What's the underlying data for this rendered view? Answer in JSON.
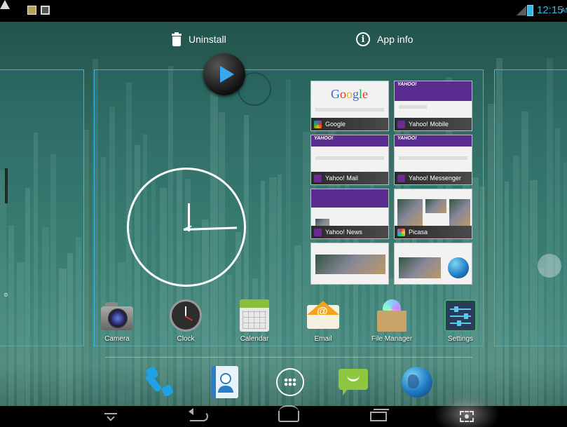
{
  "status_bar": {
    "left_icons": [
      "warning-icon",
      "sd-card-icon",
      "image-icon"
    ],
    "time": "12:15",
    "ampm": "AM",
    "accent_color": "#33b5e5"
  },
  "drop_targets": {
    "uninstall": "Uninstall",
    "app_info": "App info"
  },
  "recent_apps": [
    {
      "label": "Google",
      "icon": "google-icon"
    },
    {
      "label": "Yahoo! Mobile",
      "icon": "yahoo-icon"
    },
    {
      "label": "Yahoo! Mail",
      "icon": "yahoo-icon"
    },
    {
      "label": "Yahoo! Messenger",
      "icon": "yahoo-icon"
    },
    {
      "label": "Yahoo! News",
      "icon": "yahoo-icon"
    },
    {
      "label": "Picasa",
      "icon": "picasa-icon"
    }
  ],
  "google_logo": [
    "G",
    "o",
    "o",
    "g",
    "l",
    "e"
  ],
  "yahoo_logo": "YAHOO!",
  "workspace_apps": [
    {
      "label": "Camera",
      "icon": "camera-icon"
    },
    {
      "label": "Clock",
      "icon": "clock-icon"
    },
    {
      "label": "Calendar",
      "icon": "calendar-icon"
    },
    {
      "label": "Email",
      "icon": "email-icon"
    },
    {
      "label": "File Manager",
      "icon": "file-manager-icon"
    },
    {
      "label": "Settings",
      "icon": "settings-icon"
    }
  ],
  "dock": [
    "phone-icon",
    "contacts-icon",
    "all-apps-icon",
    "messaging-icon",
    "browser-icon"
  ],
  "email_at": "@",
  "info_glyph": "i",
  "left_edge_text": "o",
  "nav_bar": [
    "hide-keyboard-icon",
    "back-icon",
    "home-icon",
    "recent-apps-icon",
    "screenshot-icon"
  ]
}
